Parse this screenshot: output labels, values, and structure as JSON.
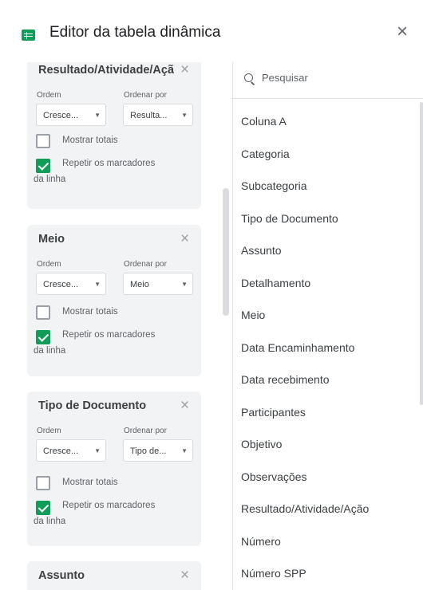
{
  "header": {
    "title": "Editor da tabela dinâmica",
    "close_icon": "×"
  },
  "cards": [
    {
      "title": "Resultado/Atividade/Ação",
      "order_label": "Ordem",
      "sort_by_label": "Ordenar por",
      "order_value": "Cresce...",
      "sort_by_value": "Resulta...",
      "show_totals": "Mostrar totais",
      "show_totals_checked": false,
      "repeat_labels_1": "Repetir os marcadores",
      "repeat_labels_2": "da linha",
      "repeat_labels_checked": true
    },
    {
      "title": "Meio",
      "order_label": "Ordem",
      "sort_by_label": "Ordenar por",
      "order_value": "Cresce...",
      "sort_by_value": "Meio",
      "show_totals": "Mostrar totais",
      "show_totals_checked": false,
      "repeat_labels_1": "Repetir os marcadores",
      "repeat_labels_2": "da linha",
      "repeat_labels_checked": true
    },
    {
      "title": "Tipo de Documento",
      "order_label": "Ordem",
      "sort_by_label": "Ordenar por",
      "order_value": "Cresce...",
      "sort_by_value": "Tipo de...",
      "show_totals": "Mostrar totais",
      "show_totals_checked": false,
      "repeat_labels_1": "Repetir os marcadores",
      "repeat_labels_2": "da linha",
      "repeat_labels_checked": true
    },
    {
      "title": "Assunto"
    }
  ],
  "search": {
    "placeholder": "Pesquisar",
    "icon": "search-icon"
  },
  "fields": [
    "Coluna A",
    "Categoria",
    "Subcategoria",
    "Tipo de Documento",
    "Assunto",
    "Detalhamento",
    "Meio",
    "Data Encaminhamento",
    "Data recebimento",
    "Participantes",
    "Objetivo",
    "Observações",
    "Resultado/Atividade/Ação",
    "Número",
    "Número SPP"
  ],
  "colors": {
    "accent_green": "#0f9d58",
    "card_bg": "#f1f3f4"
  }
}
